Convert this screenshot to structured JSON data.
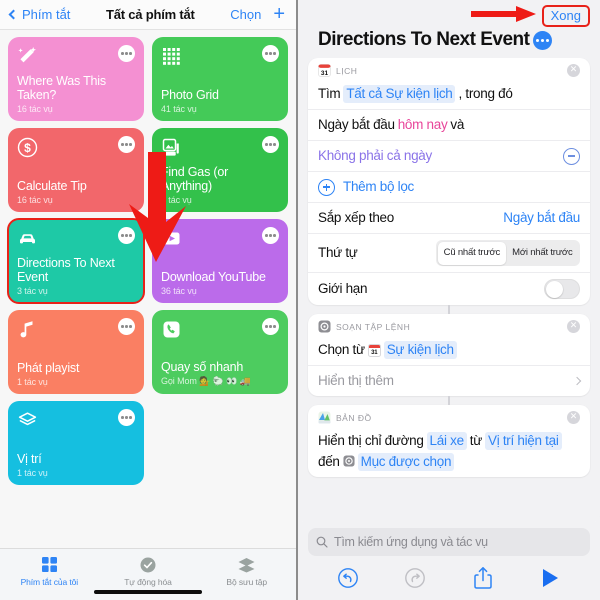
{
  "left": {
    "nav": {
      "back_label": "Phím tắt",
      "title": "Tất cả phím tắt",
      "choose_label": "Chọn",
      "add_label": "+"
    },
    "shortcuts": [
      {
        "title": "",
        "subtitle": "",
        "color": "#14c9a0",
        "icon": "none",
        "clipped": true,
        "selected": false
      },
      {
        "title": "",
        "subtitle": "",
        "color": "#3cc84a",
        "icon": "none",
        "clipped": true,
        "selected": false
      },
      {
        "title": "Where Was This Taken?",
        "subtitle": "16 tác vụ",
        "color": "#f490d2",
        "icon": "magic-wand-icon",
        "clipped": false,
        "selected": false
      },
      {
        "title": "Photo Grid",
        "subtitle": "41 tác vụ",
        "color": "#44ca58",
        "icon": "grid-dots-icon",
        "clipped": false,
        "selected": false
      },
      {
        "title": "Calculate Tip",
        "subtitle": "16 tác vụ",
        "color": "#f2676b",
        "icon": "dollar-icon",
        "clipped": false,
        "selected": false
      },
      {
        "title": "Find Gas (or Anything)",
        "subtitle": "3 tác vụ",
        "color": "#33c14b",
        "icon": "gas-photo-icon",
        "clipped": false,
        "selected": false
      },
      {
        "title": "Directions To Next Event",
        "subtitle": "3 tác vụ",
        "color": "#1ec9a6",
        "icon": "car-icon",
        "clipped": false,
        "selected": true
      },
      {
        "title": "Download YouTube",
        "subtitle": "36 tác vụ",
        "color": "#bb6bea",
        "icon": "play-box-icon",
        "clipped": false,
        "selected": false
      },
      {
        "title": "Phát playist",
        "subtitle": "1 tác vụ",
        "color": "#fa7f63",
        "icon": "music-note-icon",
        "clipped": false,
        "selected": false
      },
      {
        "title": "Quay số nhanh",
        "subtitle": "Gọi Mom 💁 🐑 👀 🚚",
        "color": "#4dcc5f",
        "icon": "phone-icon",
        "clipped": false,
        "selected": false
      },
      {
        "title": "Vị trí",
        "subtitle": "1 tác vụ",
        "color": "#15bfe0",
        "icon": "layers-icon",
        "clipped": false,
        "selected": false
      }
    ],
    "tabs": [
      {
        "label": "Phím tắt của tôi",
        "icon": "grid-squares-icon",
        "active": true
      },
      {
        "label": "Tự động hóa",
        "icon": "clock-check-icon",
        "active": false
      },
      {
        "label": "Bộ sưu tập",
        "icon": "layers-icon",
        "active": false
      }
    ]
  },
  "right": {
    "done_label": "Xong",
    "title": "Directions To Next Event",
    "more_icon": "blue-ellipsis-icon",
    "cards": [
      {
        "app": "LỊCH",
        "app_icon": "calendar-icon",
        "rows": [
          {
            "kind": "find",
            "pre": "Tìm",
            "token": "Tất cả Sự kiện lịch",
            "post": ", trong đó"
          },
          {
            "kind": "date",
            "pre": "Ngày bắt đầu",
            "token": "hôm nay",
            "post": "và"
          },
          {
            "kind": "allday",
            "label": "Không phải cả ngày",
            "control": "minus-circle-icon"
          },
          {
            "kind": "addfilter",
            "label": "Thêm bộ lọc",
            "control": "plus-circle-icon"
          },
          {
            "kind": "sort",
            "label": "Sắp xếp theo",
            "value": "Ngày bắt đầu"
          },
          {
            "kind": "order",
            "label": "Thứ tự",
            "options": [
              "Cũ nhất trước",
              "Mới nhất trước"
            ],
            "selected": 0
          },
          {
            "kind": "limit",
            "label": "Giới hạn",
            "toggle_on": false
          }
        ]
      },
      {
        "app": "SOẠN TẬP LỆNH",
        "app_icon": "scripting-gear-icon",
        "rows": [
          {
            "kind": "choose",
            "pre": "Chọn từ",
            "token": "Sự kiện lịch",
            "token_icon": "calendar-icon"
          },
          {
            "kind": "showmore",
            "label": "Hiển thị thêm"
          }
        ]
      },
      {
        "app": "BẢN ĐỒ",
        "app_icon": "maps-icon",
        "rows": [
          {
            "kind": "directions",
            "t1": "Hiển thị chỉ đường",
            "tok1": "Lái xe",
            "t2": "từ",
            "tok2": "Vị trí hiện tại",
            "t3": "đến",
            "tok3": "Mục được chọn",
            "tok3_icon": "scripting-gear-icon"
          }
        ]
      }
    ],
    "search_placeholder": "Tìm kiếm ứng dụng và tác vụ",
    "toolbar": [
      {
        "name": "undo-button",
        "icon": "undo-icon",
        "enabled": true
      },
      {
        "name": "redo-button",
        "icon": "redo-icon",
        "enabled": false
      },
      {
        "name": "share-button",
        "icon": "share-icon",
        "enabled": true
      },
      {
        "name": "play-button",
        "icon": "play-icon",
        "enabled": true
      }
    ]
  },
  "colors": {
    "accent": "#2e84f5",
    "highlight": "#e82219"
  }
}
